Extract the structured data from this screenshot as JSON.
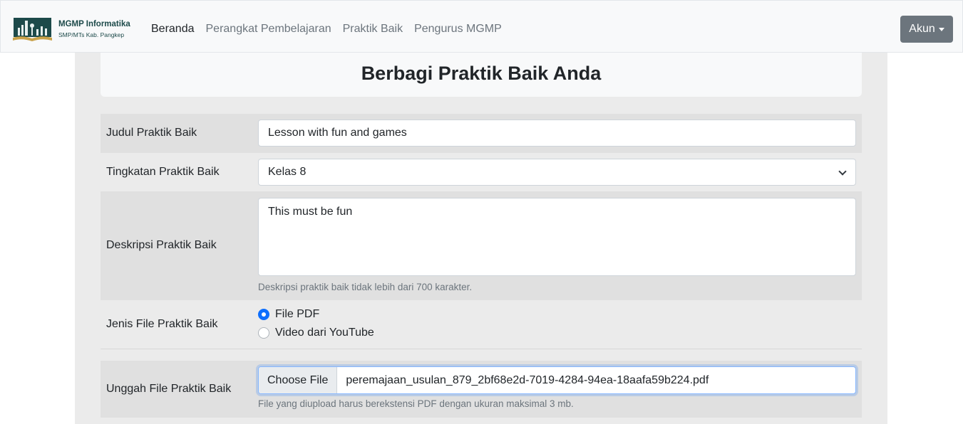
{
  "navbar": {
    "brand_title": "MGMP Informatika",
    "brand_subtitle": "SMP/MTs Kab. Pangkep",
    "links": [
      "Beranda",
      "Perangkat Pembelajaran",
      "Praktik Baik",
      "Pengurus MGMP"
    ],
    "account_label": "Akun"
  },
  "page": {
    "heading": "Berbagi Praktik Baik Anda"
  },
  "form": {
    "title": {
      "label": "Judul Praktik Baik",
      "value": "Lesson with fun and games"
    },
    "level": {
      "label": "Tingkatan Praktik Baik",
      "selected": "Kelas 8"
    },
    "description": {
      "label": "Deskripsi Praktik Baik",
      "value": "This must be fun",
      "help": "Deskripsi praktik baik tidak lebih dari 700 karakter."
    },
    "file_type": {
      "label": "Jenis File Praktik Baik",
      "options": [
        "File PDF",
        "Video dari YouTube"
      ],
      "selected": "File PDF"
    },
    "upload": {
      "label": "Unggah File Praktik Baik",
      "button": "Choose File",
      "filename": "peremajaan_usulan_879_2bf68e2d-7019-4284-94ea-18aafa59b224.pdf",
      "help": "File yang diupload harus berekstensi PDF dengan ukuran maksimal 3 mb."
    }
  },
  "colors": {
    "navbar_bg": "#f8f9fa",
    "panel_bg": "#ebebeb",
    "account_button": "#6c757d",
    "radio_checked": "#0d6efd"
  }
}
